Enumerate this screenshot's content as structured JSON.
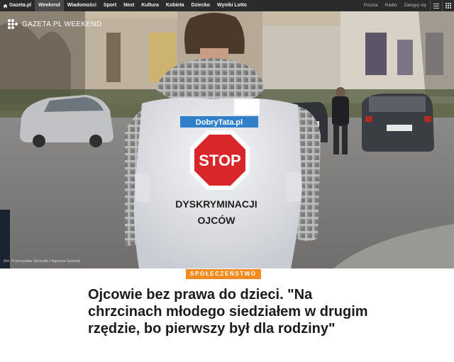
{
  "topnav": {
    "brand": "Gazeta.pl",
    "items": [
      {
        "label": "Weekend",
        "active": true
      },
      {
        "label": "Wiadomości"
      },
      {
        "label": "Sport"
      },
      {
        "label": "Next"
      },
      {
        "label": "Kultura"
      },
      {
        "label": "Kobieta"
      },
      {
        "label": "Dziecko"
      },
      {
        "label": "Wyniki Lotto"
      }
    ],
    "utils": [
      "Poczta",
      "Radio",
      "Zaloguj się"
    ],
    "icons": [
      "home-icon",
      "menu-icon",
      "apps-grid-icon"
    ]
  },
  "hero": {
    "logo_text": "GAZETA.PL WEEKEND",
    "shirt": {
      "banner": "DobryTata.pl",
      "sign": "STOP",
      "line1": "DYSKRYMINACJI",
      "line2": "OJCÓW"
    },
    "credit": "(fot. Przemysław Skrzydło / Agencja Gazeta)"
  },
  "article": {
    "category": "SPOŁECZEŃSTWO",
    "category_color": "#f28b20",
    "headline": "Ojcowie bez prawa do dzieci. \"Na chrzcinach młodego siedziałem w drugim rzędzie, bo pierwszy był dla rodziny\""
  }
}
